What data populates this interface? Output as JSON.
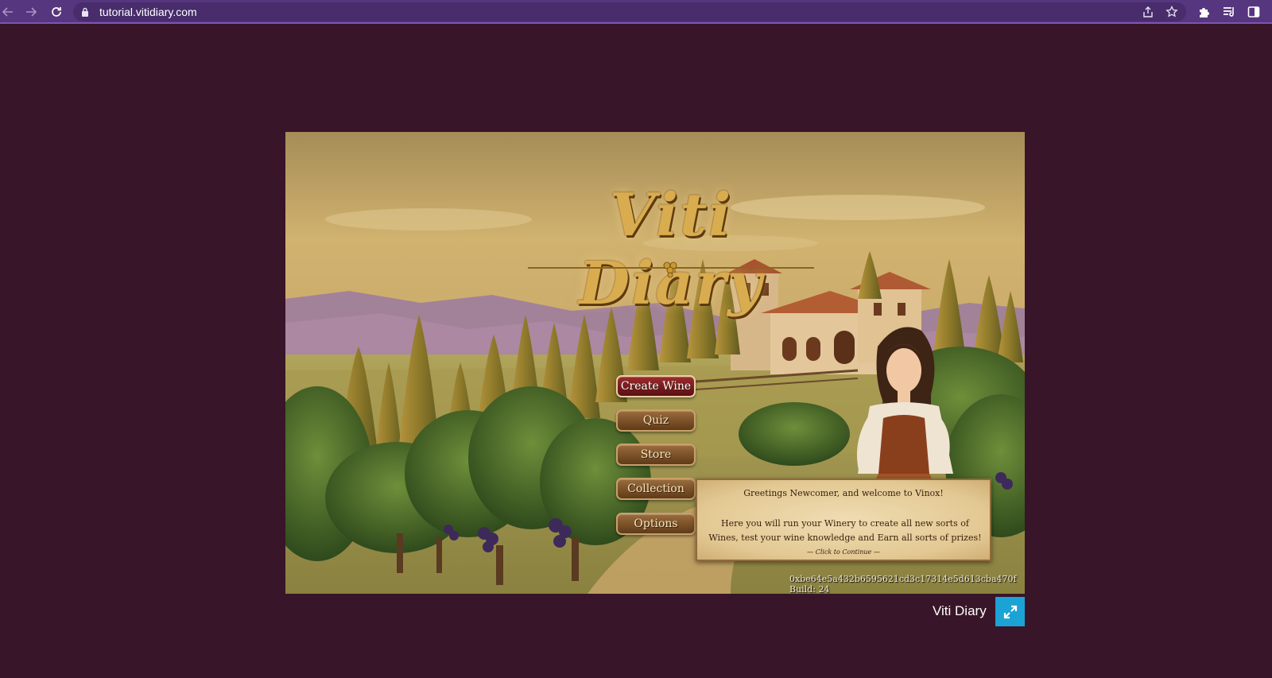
{
  "browser": {
    "url": "tutorial.vitidiary.com",
    "nav_icons": [
      "back-icon",
      "forward-icon",
      "reload-icon"
    ],
    "omnibox_icons": [
      "lock-icon",
      "share-icon",
      "star-icon"
    ],
    "extension_icons": [
      "puzzle-icon",
      "media-queue-icon",
      "side-panel-icon"
    ]
  },
  "game": {
    "logo_text": "Viti Diary",
    "menu": [
      {
        "label": "Create Wine",
        "highlighted": true
      },
      {
        "label": "Quiz",
        "highlighted": false
      },
      {
        "label": "Store",
        "highlighted": false
      },
      {
        "label": "Collection",
        "highlighted": false
      },
      {
        "label": "Options",
        "highlighted": false
      }
    ],
    "dialog": {
      "title": "Greetings Newcomer, and welcome to Vinox!",
      "body": "Here you will run your Winery to create all new sorts of Wines, test your wine knowledge and Earn all sorts of prizes!",
      "hint": "— Click to Continue —"
    },
    "build_info": "0xbe64e5a432b6595621cd3c17314e5d613cba470f Build: 24"
  },
  "footer": {
    "title": "Viti Diary",
    "fullscreen_icon": "fullscreen-icon"
  },
  "colors": {
    "page_background": "#381528",
    "toolbar": "#56367e",
    "fullscreen_button": "#1ba3d6",
    "primary_button": "#7a1a1f",
    "menu_button": "#7a5027"
  }
}
